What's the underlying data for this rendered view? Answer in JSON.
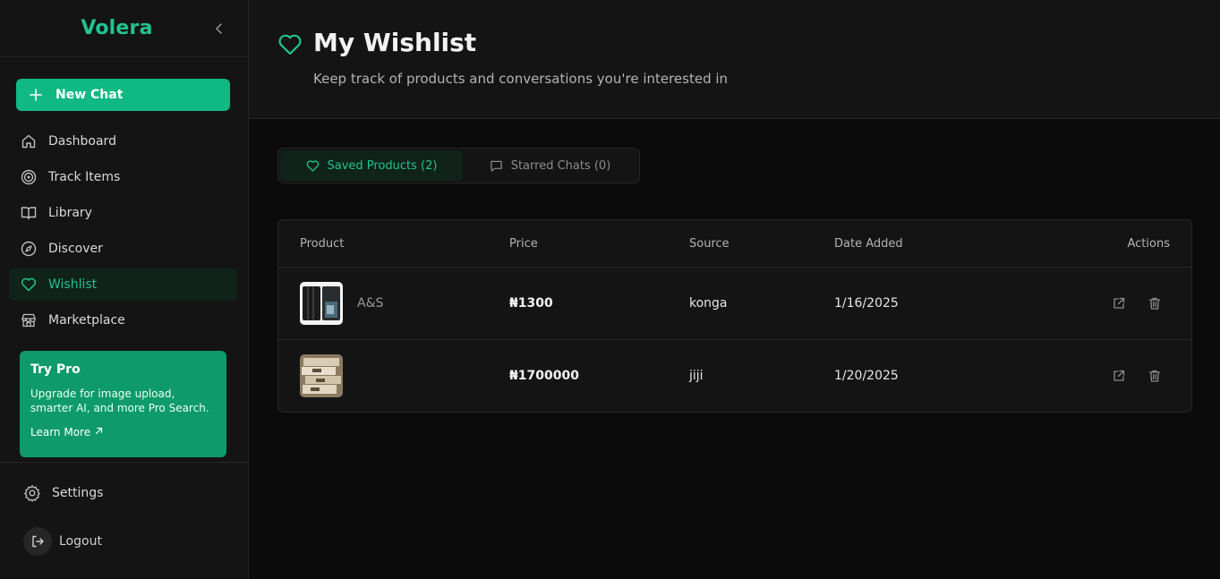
{
  "brand": {
    "name": "Volera"
  },
  "sidebar": {
    "new_chat_label": "New Chat",
    "items": [
      {
        "label": "Dashboard",
        "icon": "home-icon"
      },
      {
        "label": "Track Items",
        "icon": "target-icon"
      },
      {
        "label": "Library",
        "icon": "book-icon"
      },
      {
        "label": "Discover",
        "icon": "compass-icon"
      },
      {
        "label": "Wishlist",
        "icon": "heart-icon",
        "active": true
      },
      {
        "label": "Marketplace",
        "icon": "store-icon"
      }
    ],
    "pro_card": {
      "title": "Try Pro",
      "description": "Upgrade for image upload, smarter AI, and more Pro Search.",
      "link_label": "Learn More",
      "color": "#0e9a6a"
    },
    "settings_label": "Settings",
    "logout_label": "Logout"
  },
  "header": {
    "title": "My Wishlist",
    "subtitle": "Keep track of products and conversations you're interested in"
  },
  "tabs": [
    {
      "label": "Saved Products (2)",
      "icon": "heart-icon",
      "active": true
    },
    {
      "label": "Starred Chats (0)",
      "icon": "chat-bubble-icon",
      "active": false
    }
  ],
  "table": {
    "columns": [
      "Product",
      "Price",
      "Source",
      "Date Added",
      "Actions"
    ],
    "rows": [
      {
        "product": "A&S",
        "thumbnail": "tablet-case-image",
        "price": "₦1300",
        "source": "konga",
        "date_added": "1/16/2025"
      },
      {
        "product": "",
        "thumbnail": "stacked-boxes-image",
        "price": "₦1700000",
        "source": "jiji",
        "date_added": "1/20/2025"
      }
    ]
  },
  "colors": {
    "accent": "#10b981",
    "accent_text": "#22c38e",
    "background": "#0b0b0b",
    "panel": "#141414"
  }
}
